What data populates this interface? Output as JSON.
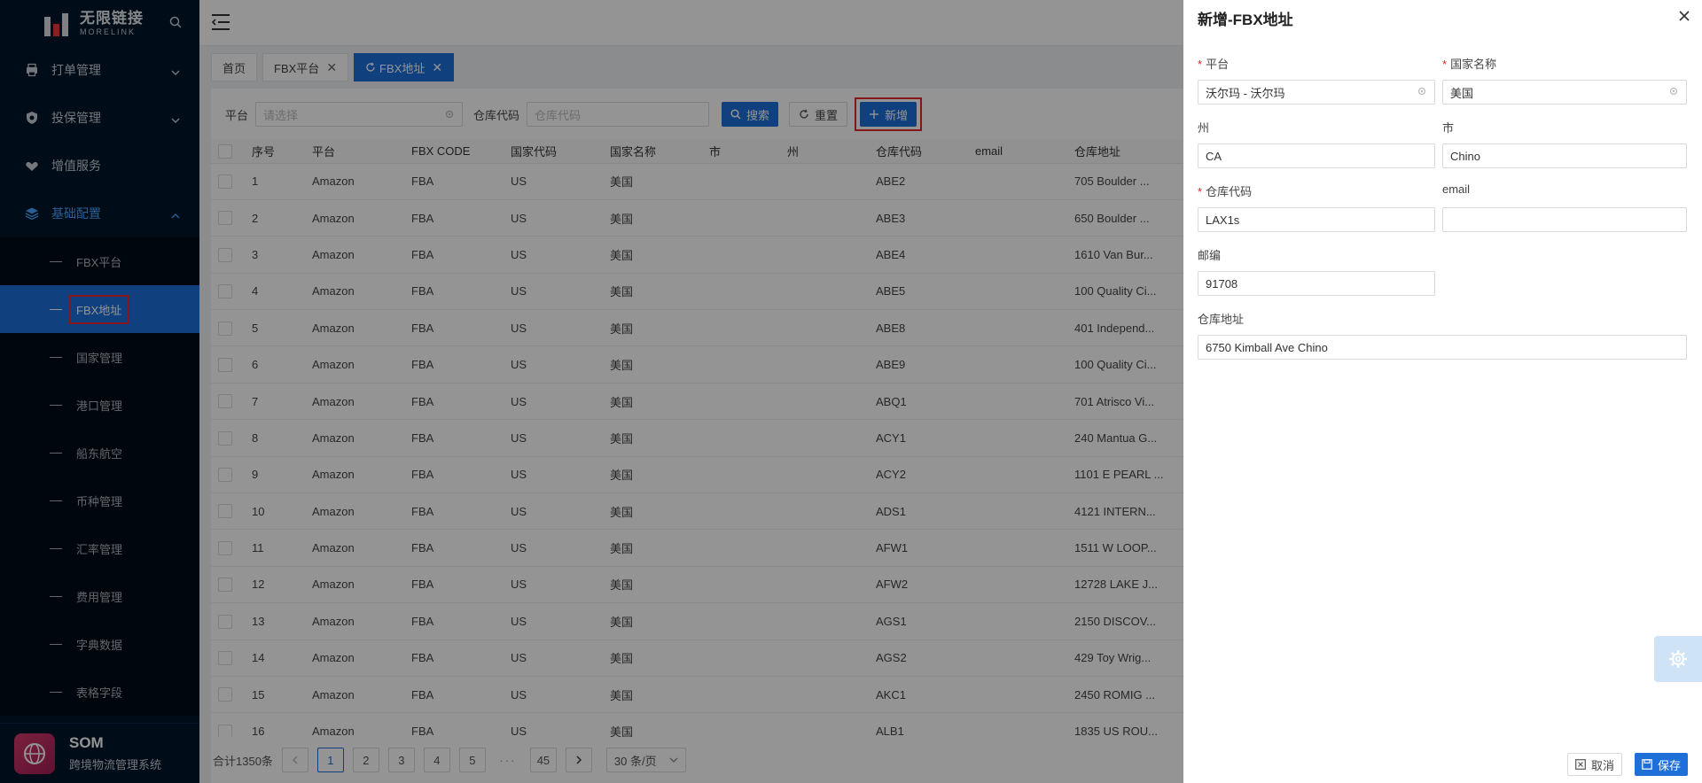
{
  "app": {
    "logo_cn": "无限链接",
    "logo_en": "MORELINK",
    "footer_title": "SOM",
    "footer_subtitle": "跨境物流管理系统"
  },
  "sidebar": {
    "menus": [
      {
        "label": "打单管理",
        "icon": "printer-icon",
        "chevron": "down"
      },
      {
        "label": "投保管理",
        "icon": "shield-icon",
        "chevron": "down"
      },
      {
        "label": "增值服务",
        "icon": "gift-icon",
        "chevron": ""
      },
      {
        "label": "基础配置",
        "icon": "layers-icon",
        "chevron": "up"
      }
    ],
    "submenus": [
      "FBX平台",
      "FBX地址",
      "国家管理",
      "港口管理",
      "船东航空",
      "币种管理",
      "汇率管理",
      "费用管理",
      "字典数据",
      "表格字段"
    ],
    "active_submenu": "FBX地址"
  },
  "tabs": [
    {
      "label": "首页",
      "closable": false,
      "active": false
    },
    {
      "label": "FBX平台",
      "closable": true,
      "active": false
    },
    {
      "label": "FBX地址",
      "closable": true,
      "active": true
    }
  ],
  "filters": {
    "platform_label": "平台",
    "platform_placeholder": "请选择",
    "warehouse_label": "仓库代码",
    "warehouse_placeholder": "仓库代码",
    "search_label": "搜索",
    "reset_label": "重置",
    "add_label": "新增"
  },
  "table": {
    "columns": [
      "序号",
      "平台",
      "FBX CODE",
      "国家代码",
      "国家名称",
      "市",
      "州",
      "仓库代码",
      "email",
      "仓库地址"
    ],
    "rows": [
      [
        "1",
        "Amazon",
        "FBA",
        "US",
        "美国",
        "",
        "",
        "ABE2",
        "",
        "705 Boulder ..."
      ],
      [
        "2",
        "Amazon",
        "FBA",
        "US",
        "美国",
        "",
        "",
        "ABE3",
        "",
        "650 Boulder ..."
      ],
      [
        "3",
        "Amazon",
        "FBA",
        "US",
        "美国",
        "",
        "",
        "ABE4",
        "",
        "1610 Van Bur..."
      ],
      [
        "4",
        "Amazon",
        "FBA",
        "US",
        "美国",
        "",
        "",
        "ABE5",
        "",
        "100 Quality Ci..."
      ],
      [
        "5",
        "Amazon",
        "FBA",
        "US",
        "美国",
        "",
        "",
        "ABE8",
        "",
        "401 Independ..."
      ],
      [
        "6",
        "Amazon",
        "FBA",
        "US",
        "美国",
        "",
        "",
        "ABE9",
        "",
        "100 Quality Ci..."
      ],
      [
        "7",
        "Amazon",
        "FBA",
        "US",
        "美国",
        "",
        "",
        "ABQ1",
        "",
        "701 Atrisco Vi..."
      ],
      [
        "8",
        "Amazon",
        "FBA",
        "US",
        "美国",
        "",
        "",
        "ACY1",
        "",
        "240 Mantua G..."
      ],
      [
        "9",
        "Amazon",
        "FBA",
        "US",
        "美国",
        "",
        "",
        "ACY2",
        "",
        "1101 E PEARL ..."
      ],
      [
        "10",
        "Amazon",
        "FBA",
        "US",
        "美国",
        "",
        "",
        "ADS1",
        "",
        "4121 INTERN..."
      ],
      [
        "11",
        "Amazon",
        "FBA",
        "US",
        "美国",
        "",
        "",
        "AFW1",
        "",
        "1511 W LOOP..."
      ],
      [
        "12",
        "Amazon",
        "FBA",
        "US",
        "美国",
        "",
        "",
        "AFW2",
        "",
        "12728 LAKE J..."
      ],
      [
        "13",
        "Amazon",
        "FBA",
        "US",
        "美国",
        "",
        "",
        "AGS1",
        "",
        "2150 DISCOV..."
      ],
      [
        "14",
        "Amazon",
        "FBA",
        "US",
        "美国",
        "",
        "",
        "AGS2",
        "",
        "429 Toy Wrig..."
      ],
      [
        "15",
        "Amazon",
        "FBA",
        "US",
        "美国",
        "",
        "",
        "AKC1",
        "",
        "2450 ROMIG ..."
      ],
      [
        "16",
        "Amazon",
        "FBA",
        "US",
        "美国",
        "",
        "",
        "ALB1",
        "",
        "1835 US ROU..."
      ]
    ]
  },
  "pagination": {
    "total": "合计1350条",
    "pages": [
      "1",
      "2",
      "3",
      "4",
      "5"
    ],
    "ellipsis": "···",
    "last": "45",
    "current": "1",
    "page_size": "30 条/页"
  },
  "drawer": {
    "title": "新增-FBX地址",
    "fields": {
      "platform": {
        "label": "平台",
        "value": "沃尔玛 - 沃尔玛",
        "required": true
      },
      "country": {
        "label": "国家名称",
        "value": "美国",
        "required": true
      },
      "state": {
        "label": "州",
        "value": "CA",
        "required": false
      },
      "city": {
        "label": "市",
        "value": "Chino",
        "required": false
      },
      "warehouse": {
        "label": "仓库代码",
        "value": "LAX1s",
        "required": true
      },
      "email": {
        "label": "email",
        "value": "",
        "required": false
      },
      "zip": {
        "label": "邮编",
        "value": "91708",
        "required": false
      },
      "address": {
        "label": "仓库地址",
        "value": "6750 Kimball Ave Chino",
        "required": false
      }
    },
    "cancel_label": "取消",
    "save_label": "保存"
  },
  "colors": {
    "sidebar_bg": "#001529",
    "accent": "#1e6fd9",
    "highlight_box": "#e5262f"
  }
}
